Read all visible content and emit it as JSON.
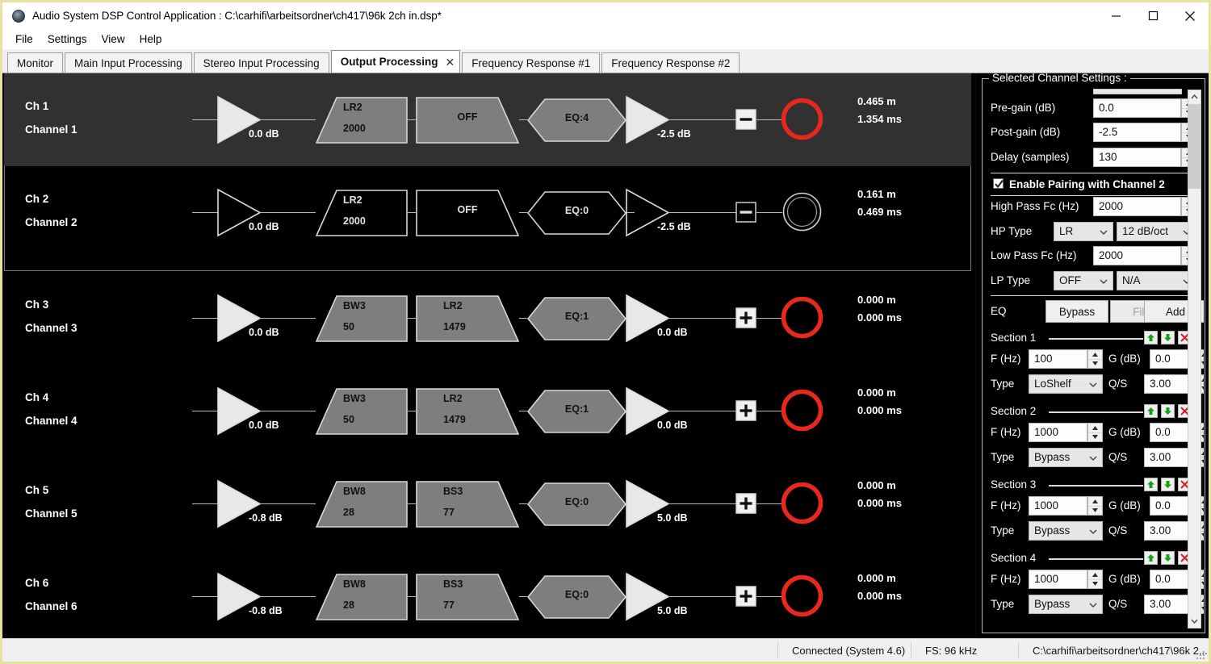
{
  "window": {
    "title": "Audio System DSP Control Application : C:\\carhifi\\arbeitsordner\\ch417\\96k 2ch in.dsp*",
    "icon": "app-icon",
    "minimize": "–",
    "maximize": "☐",
    "close": "✕"
  },
  "menu": {
    "items": [
      "File",
      "Settings",
      "View",
      "Help"
    ]
  },
  "tabs": [
    {
      "label": "Monitor",
      "active": false,
      "closable": false
    },
    {
      "label": "Main Input Processing",
      "active": false,
      "closable": false
    },
    {
      "label": "Stereo Input Processing",
      "active": false,
      "closable": false
    },
    {
      "label": "Output Processing",
      "active": true,
      "closable": true,
      "close_glyph": "✕"
    },
    {
      "label": "Frequency Response #1",
      "active": false,
      "closable": false
    },
    {
      "label": "Frequency Response #2",
      "active": false,
      "closable": false
    }
  ],
  "channels": [
    {
      "id": "Ch 1",
      "name": "Channel 1",
      "selected": true,
      "filled": true,
      "pre_gain": "0.0 dB",
      "hp": {
        "type": "LR2",
        "freq": "2000",
        "shape": "highpass"
      },
      "lp": {
        "type": "OFF",
        "freq": "",
        "shape": "lowpass"
      },
      "eq": "EQ:4",
      "post_gain": "-2.5 dB",
      "polarity": "minus",
      "speaker_active": true,
      "delay_m": "0.465 m",
      "delay_ms": "1.354 ms"
    },
    {
      "id": "Ch 2",
      "name": "Channel 2",
      "selected": false,
      "filled": false,
      "pre_gain": "0.0 dB",
      "hp": {
        "type": "LR2",
        "freq": "2000",
        "shape": "highpass"
      },
      "lp": {
        "type": "OFF",
        "freq": "",
        "shape": "lowpass"
      },
      "eq": "EQ:0",
      "post_gain": "-2.5 dB",
      "polarity": "minus",
      "speaker_active": false,
      "delay_m": "0.161 m",
      "delay_ms": "0.469 ms"
    },
    {
      "id": "Ch 3",
      "name": "Channel 3",
      "selected": false,
      "filled": true,
      "pre_gain": "0.0 dB",
      "hp": {
        "type": "BW3",
        "freq": "50",
        "shape": "highpass"
      },
      "lp": {
        "type": "LR2",
        "freq": "1479",
        "shape": "lowpass"
      },
      "eq": "EQ:1",
      "post_gain": "0.0 dB",
      "polarity": "plus",
      "speaker_active": true,
      "delay_m": "0.000 m",
      "delay_ms": "0.000 ms"
    },
    {
      "id": "Ch 4",
      "name": "Channel 4",
      "selected": false,
      "filled": true,
      "pre_gain": "0.0 dB",
      "hp": {
        "type": "BW3",
        "freq": "50",
        "shape": "highpass"
      },
      "lp": {
        "type": "LR2",
        "freq": "1479",
        "shape": "lowpass"
      },
      "eq": "EQ:1",
      "post_gain": "0.0 dB",
      "polarity": "plus",
      "speaker_active": true,
      "delay_m": "0.000 m",
      "delay_ms": "0.000 ms"
    },
    {
      "id": "Ch 5",
      "name": "Channel 5",
      "selected": false,
      "filled": true,
      "pre_gain": "-0.8 dB",
      "hp": {
        "type": "BW8",
        "freq": "28",
        "shape": "highpass"
      },
      "lp": {
        "type": "BS3",
        "freq": "77",
        "shape": "lowpass"
      },
      "eq": "EQ:0",
      "post_gain": "5.0 dB",
      "polarity": "plus",
      "speaker_active": true,
      "delay_m": "0.000 m",
      "delay_ms": "0.000 ms"
    },
    {
      "id": "Ch 6",
      "name": "Channel 6",
      "selected": false,
      "filled": true,
      "pre_gain": "-0.8 dB",
      "hp": {
        "type": "BW8",
        "freq": "28",
        "shape": "highpass"
      },
      "lp": {
        "type": "BS3",
        "freq": "77",
        "shape": "lowpass"
      },
      "eq": "EQ:0",
      "post_gain": "5.0 dB",
      "polarity": "plus",
      "speaker_active": true,
      "delay_m": "0.000 m",
      "delay_ms": "0.000 ms"
    }
  ],
  "settings": {
    "group_title": "Selected Channel Settings :",
    "pre_gain": {
      "label": "Pre-gain (dB)",
      "value": "0.0"
    },
    "post_gain": {
      "label": "Post-gain (dB)",
      "value": "-2.5"
    },
    "delay": {
      "label": "Delay (samples)",
      "value": "130"
    },
    "pairing": {
      "label": "Enable Pairing with Channel 2",
      "checked": true
    },
    "high_pass_fc": {
      "label": "High Pass Fc (Hz)",
      "value": "2000"
    },
    "hp_type": {
      "label": "HP Type",
      "family": "LR",
      "slope": "12 dB/oct"
    },
    "low_pass_fc": {
      "label": "Low Pass Fc (Hz)",
      "value": "2000"
    },
    "lp_type": {
      "label": "LP Type",
      "family": "OFF",
      "slope": "N/A"
    },
    "eq": {
      "label": "EQ",
      "bypass_label": "Bypass",
      "file_label": "File",
      "add_label": "Add",
      "file_disabled": true
    },
    "field_labels": {
      "freq": "F (Hz)",
      "gain": "G (dB)",
      "type": "Type",
      "q": "Q/S"
    },
    "sections": [
      {
        "title": "Section 1",
        "freq": "100",
        "gain": "0.0",
        "type": "LoShelf",
        "q": "3.00"
      },
      {
        "title": "Section 2",
        "freq": "1000",
        "gain": "0.0",
        "type": "Bypass",
        "q": "3.00"
      },
      {
        "title": "Section 3",
        "freq": "1000",
        "gain": "0.0",
        "type": "Bypass",
        "q": "3.00"
      },
      {
        "title": "Section 4",
        "freq": "1000",
        "gain": "0.0",
        "type": "Bypass",
        "q": "3.00"
      }
    ]
  },
  "statusbar": {
    "connection": "Connected (System 4.6)",
    "fs": "FS: 96 kHz",
    "file": "C:\\carhifi\\arbeitsordner\\ch417\\96k 2..."
  },
  "colors": {
    "speaker_red": "#e8271f",
    "panel_bg": "#000000",
    "selected_row": "#313131",
    "shape_fill": "#7e7e7e",
    "accent_frame": "#e8e2a0",
    "section_up": "#16a016",
    "section_down": "#16a016",
    "section_delete": "#d02020"
  }
}
